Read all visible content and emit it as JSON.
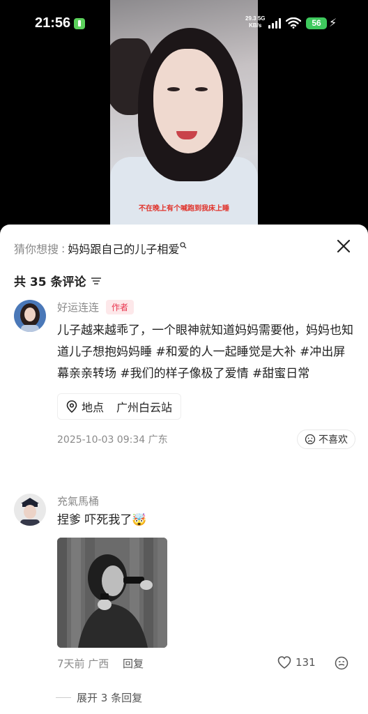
{
  "status": {
    "time": "21:56",
    "net_speed_value": "29.3",
    "net_type": "5G",
    "net_unit": "KB/s",
    "battery": "56"
  },
  "video": {
    "subtitle": "不在晚上有个喊跑到我床上睡"
  },
  "guess_search": {
    "prefix": "猜你想搜",
    "separator": ":",
    "query": "妈妈跟自己的儿子相爱"
  },
  "comments_header": {
    "count_label": "共 35 条评论"
  },
  "comments": [
    {
      "username": "好运连连",
      "tag": "作者",
      "text": "儿子越来越乖了，一个眼神就知道妈妈需要他，妈妈也知道儿子想抱妈妈睡 #和爱的人一起睡觉是大补 #冲出屏幕亲亲转场 #我们的样子像极了爱情 #甜蜜日常",
      "location_label": "地点",
      "location_value": "广州白云站",
      "date": "2025-10-03 09:34 广东",
      "dislike_label": "不喜欢"
    },
    {
      "username": "充氣馬桶",
      "text": "捏爹 吓死我了🤯",
      "time_location": "7天前 广西",
      "reply_label": "回复",
      "likes": "131",
      "expand_label": "展开 3 条回复"
    }
  ],
  "icons": {
    "close": "close-icon",
    "filter": "filter-icon",
    "location": "location-pin-icon",
    "dislike": "dislike-face-icon",
    "like": "heart-icon",
    "emoji": "emoji-icon"
  }
}
